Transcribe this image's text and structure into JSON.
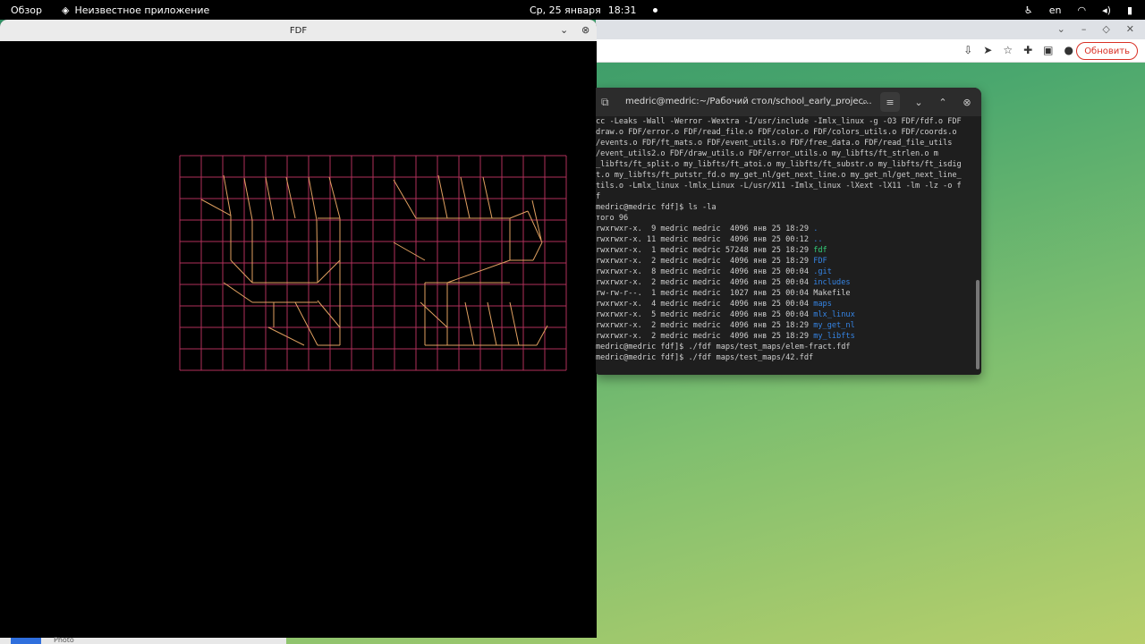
{
  "topbar": {
    "overview": "Обзор",
    "app_name": "Неизвестное приложение",
    "date": "Ср, 25 января",
    "time": "18:31",
    "lang": "en"
  },
  "browser": {
    "update_label": "Обновить"
  },
  "fdf": {
    "title": "FDF",
    "grid_color": "#b0305a",
    "relief_color": "#e0a060"
  },
  "terminal": {
    "title": "medric@medric:~/Рабочий стол/school_early_projec...",
    "lines": [
      {
        "text": "cc -Leaks -Wall -Werror -Wextra -I/usr/include -Imlx_linux -g -O3 FDF/fdf.o FDF"
      },
      {
        "text": "draw.o FDF/error.o FDF/read_file.o FDF/color.o FDF/colors_utils.o FDF/coords.o"
      },
      {
        "text": "/events.o FDF/ft_mats.o FDF/event_utils.o FDF/free_data.o FDF/read_file_utils"
      },
      {
        "text": "/event_utils2.o FDF/draw_utils.o FDF/error_utils.o my_libfts/ft_strlen.o m"
      },
      {
        "text": "_libfts/ft_split.o my_libfts/ft_atoi.o my_libfts/ft_substr.o my_libfts/ft_isdig"
      },
      {
        "text": "t.o my_libfts/ft_putstr_fd.o my_get_nl/get_next_line.o my_get_nl/get_next_line_"
      },
      {
        "text": "tils.o -Lmlx_linux -lmlx_Linux -L/usr/X11 -Imlx_linux -lXext -lX11 -lm -lz -o f"
      },
      {
        "text": "f"
      },
      {
        "text": "medric@medric fdf]$ ls -la"
      },
      {
        "text": "того 96"
      },
      {
        "text": "rwxrwxr-x.  9 medric medric  4096 янв 25 18:29 ",
        "name": ".",
        "color": "blue"
      },
      {
        "text": "rwxrwxr-x. 11 medric medric  4096 янв 25 00:12 ",
        "name": "..",
        "color": "blue"
      },
      {
        "text": "rwxrwxr-x.  1 medric medric 57248 янв 25 18:29 ",
        "name": "fdf",
        "color": "green"
      },
      {
        "text": "rwxrwxr-x.  2 medric medric  4096 янв 25 18:29 ",
        "name": "FDF",
        "color": "blue"
      },
      {
        "text": "rwxrwxr-x.  8 medric medric  4096 янв 25 00:04 ",
        "name": ".git",
        "color": "blue"
      },
      {
        "text": "rwxrwxr-x.  2 medric medric  4096 янв 25 00:04 ",
        "name": "includes",
        "color": "blue"
      },
      {
        "text": "rw-rw-r--.  1 medric medric  1027 янв 25 00:04 ",
        "name": "Makefile",
        "color": ""
      },
      {
        "text": "rwxrwxr-x.  4 medric medric  4096 янв 25 00:04 ",
        "name": "maps",
        "color": "blue"
      },
      {
        "text": "rwxrwxr-x.  5 medric medric  4096 янв 25 00:04 ",
        "name": "mlx_linux",
        "color": "blue"
      },
      {
        "text": "rwxrwxr-x.  2 medric medric  4096 янв 25 18:29 ",
        "name": "my_get_nl",
        "color": "blue"
      },
      {
        "text": "rwxrwxr-x.  2 medric medric  4096 янв 25 18:29 ",
        "name": "my_libfts",
        "color": "blue"
      },
      {
        "text": "medric@medric fdf]$ ./fdf maps/test_maps/elem-fract.fdf"
      },
      {
        "text": "medric@medric fdf]$ ./fdf maps/test_maps/42.fdf"
      }
    ]
  },
  "dock": {
    "label": "Photo"
  }
}
